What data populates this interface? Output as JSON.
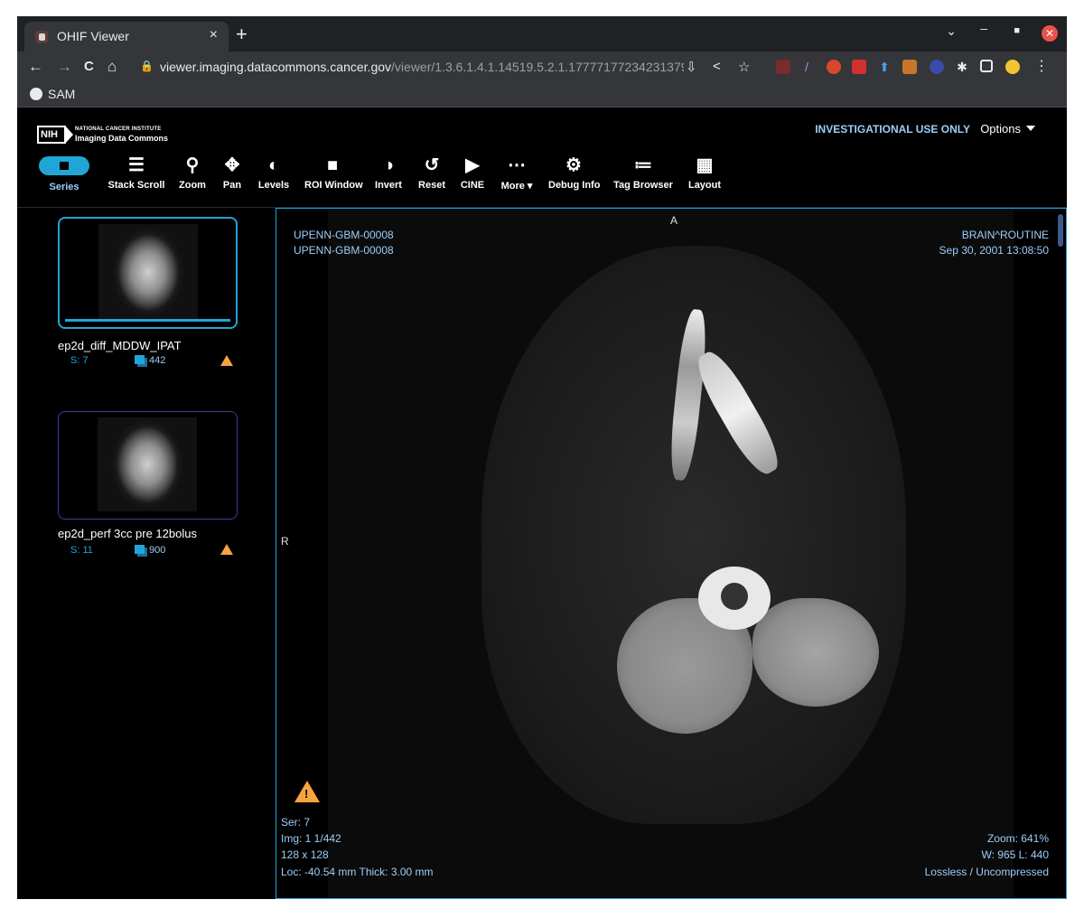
{
  "browser": {
    "tab_title": "OHIF Viewer",
    "tab_close": "×",
    "new_tab": "+",
    "url_host": "viewer.imaging.datacommons.cancer.gov",
    "url_path": "/viewer/1.3.6.1.4.1.14519.5.2.1.177771772342313796...",
    "bookmark": "SAM",
    "nav": {
      "back": "←",
      "forward": "→",
      "reload": "C",
      "home": "⌂"
    }
  },
  "app": {
    "logo_line1": "NATIONAL CANCER INSTITUTE",
    "logo_line2": "Imaging Data Commons",
    "logo_badge": "NIH",
    "notice": "INVESTIGATIONAL USE ONLY",
    "options_label": "Options"
  },
  "toolbar": {
    "series": "Series",
    "stack_scroll": "Stack Scroll",
    "zoom": "Zoom",
    "pan": "Pan",
    "levels": "Levels",
    "roi_window": "ROI Window",
    "invert": "Invert",
    "reset": "Reset",
    "cine": "CINE",
    "more": "More",
    "debug_info": "Debug Info",
    "tag_browser": "Tag Browser",
    "layout": "Layout"
  },
  "series": [
    {
      "name": "ep2d_diff_MDDW_IPAT",
      "s_label": "S: 7",
      "count": "442"
    },
    {
      "name": "ep2d_perf 3cc pre 12bolus",
      "s_label": "S: 11",
      "count": "900"
    }
  ],
  "viewport": {
    "orientation_top": "A",
    "orientation_left": "R",
    "patient_id_1": "UPENN-GBM-00008",
    "patient_id_2": "UPENN-GBM-00008",
    "study": "BRAIN^ROUTINE",
    "date": "Sep 30, 2001 13:08:50",
    "ser": "Ser: 7",
    "img": "Img: 1 1/442",
    "dims": "128 x 128",
    "loc": "Loc: -40.54 mm Thick: 3.00 mm",
    "zoom": "Zoom: 641%",
    "wl": "W: 965 L: 440",
    "compression": "Lossless / Uncompressed"
  }
}
